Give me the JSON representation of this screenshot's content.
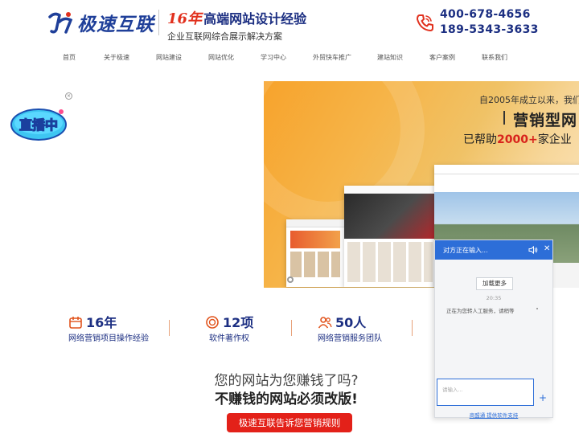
{
  "header": {
    "logo_text": "极速互联",
    "slogan_years": "16年",
    "slogan_title": "高端网站设计经验",
    "slogan_sub": "企业互联网综合展示解决方案",
    "phone_1": "400-678-4656",
    "phone_2": "189-5343-3633"
  },
  "nav": {
    "items": [
      {
        "label": "首页"
      },
      {
        "label": "关于极速"
      },
      {
        "label": "网站建设"
      },
      {
        "label": "网站优化"
      },
      {
        "label": "学习中心"
      },
      {
        "label": "外贸快车推广"
      },
      {
        "label": "建站知识"
      },
      {
        "label": "客户案例"
      },
      {
        "label": "联系我们"
      }
    ]
  },
  "live_badge": {
    "label": "直播中",
    "close_label": "×"
  },
  "banner": {
    "top_text": "自2005年成立以来，我们",
    "title": "营销型网",
    "tag_prefix": "已帮助",
    "tag_highlight": "2000+",
    "tag_suffix": "家企业"
  },
  "stats": [
    {
      "number": "16年",
      "label": "网络营销项目操作经验",
      "icon": "calendar-icon"
    },
    {
      "number": "12项",
      "label": "软件著作权",
      "icon": "medal-icon"
    },
    {
      "number": "50人",
      "label": "网络营销服务团队",
      "icon": "team-icon"
    }
  ],
  "pitch": {
    "line1": "您的网站为您赚钱了吗?",
    "line2": "不赚钱的网站必须改版!",
    "cta": "极速互联告诉您营销规则"
  },
  "chat": {
    "title": "对方正在输入...",
    "load_more": "加载更多",
    "time": "20:35",
    "message": "正在为您转人工服务，请稍等",
    "input_placeholder": "请输入...",
    "footer": "商盟通 提供软件支持",
    "accent": "#2d6ed8"
  },
  "colors": {
    "brand_blue": "#1c2f82",
    "brand_red": "#e32119"
  }
}
